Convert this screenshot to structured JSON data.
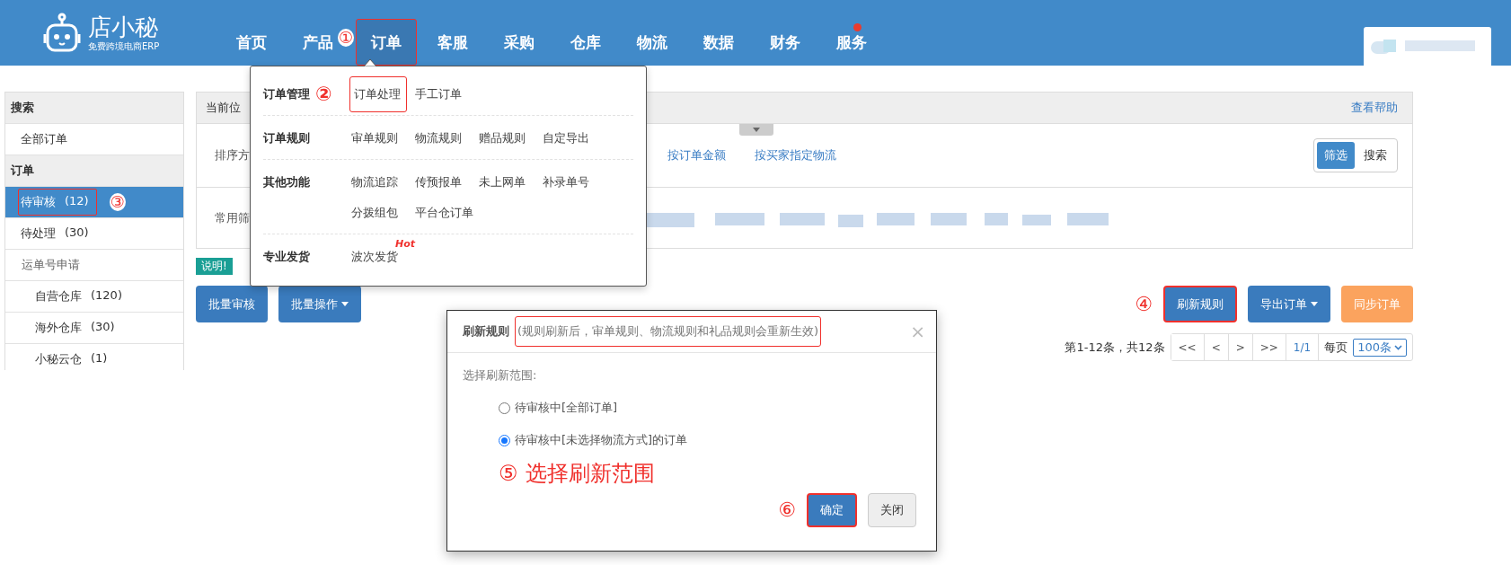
{
  "app": {
    "logo_name": "店小秘",
    "logo_tagline": "免费跨境电商ERP"
  },
  "nav": [
    {
      "label": "首页",
      "selected": false,
      "highlighted": false,
      "notification": false
    },
    {
      "label": "产品",
      "selected": false,
      "highlighted": false,
      "notification": false
    },
    {
      "label": "订单",
      "selected": true,
      "highlighted": true,
      "notification": false,
      "annotation": "①"
    },
    {
      "label": "客服",
      "selected": false,
      "highlighted": false,
      "notification": false
    },
    {
      "label": "采购",
      "selected": false,
      "highlighted": false,
      "notification": false
    },
    {
      "label": "仓库",
      "selected": false,
      "highlighted": false,
      "notification": false
    },
    {
      "label": "物流",
      "selected": false,
      "highlighted": false,
      "notification": false
    },
    {
      "label": "数据",
      "selected": false,
      "highlighted": false,
      "notification": false
    },
    {
      "label": "财务",
      "selected": false,
      "highlighted": false,
      "notification": false
    },
    {
      "label": "服务",
      "selected": false,
      "highlighted": false,
      "notification": true
    }
  ],
  "sidebar": [
    {
      "kind": "header",
      "label": "搜索"
    },
    {
      "kind": "item",
      "label": "全部订单",
      "selected": false,
      "highlighted": false
    },
    {
      "kind": "header",
      "label": "订单"
    },
    {
      "kind": "item",
      "label": "待审核",
      "count": "(12)",
      "selected": true,
      "highlighted": true,
      "annotation": "③"
    },
    {
      "kind": "item",
      "label": "待处理",
      "count": "(30)",
      "selected": false,
      "highlighted": false
    },
    {
      "kind": "group",
      "label": "运单号申请",
      "children": [
        {
          "kind": "item",
          "label": "自营仓库",
          "count": "(120)",
          "selected": false,
          "highlighted": false
        },
        {
          "kind": "item",
          "label": "海外仓库",
          "count": "(30)",
          "selected": false,
          "highlighted": false
        },
        {
          "kind": "item",
          "label": "小秘云仓",
          "count": "(1)",
          "selected": false,
          "highlighted": false
        }
      ]
    }
  ],
  "main": {
    "breadcrumb": "当前位",
    "help_link": "查看帮助",
    "sort_label": "排序方",
    "sort_options": [
      "按订单金额",
      "按买家指定物流"
    ],
    "view_toggle": [
      {
        "label": "筛选",
        "selected": true
      },
      {
        "label": "搜索",
        "selected": false
      }
    ],
    "filter_label": "常用筛",
    "notice": "说明!",
    "left_actions": [
      {
        "label": "批量审核",
        "dropdown": false
      },
      {
        "label": "批量操作",
        "dropdown": true
      }
    ],
    "right_actions": [
      {
        "label": "刷新规则",
        "kind": "primary",
        "dropdown": false,
        "highlighted": true,
        "annotation": "④"
      },
      {
        "label": "导出订单",
        "kind": "primary",
        "dropdown": true,
        "highlighted": false
      },
      {
        "label": "同步订单",
        "kind": "warning",
        "dropdown": false,
        "highlighted": false
      }
    ],
    "pagination": {
      "summary": "第1-12条，共12条",
      "buttons": [
        "<<",
        "<",
        ">",
        ">>"
      ],
      "page": "1/1",
      "per_page_label": "每页",
      "per_page": "100条"
    }
  },
  "menu": {
    "sections": [
      {
        "label": "订单管理",
        "annotation": "②",
        "links": [
          {
            "label": "订单处理",
            "highlighted": true
          },
          {
            "label": "手工订单",
            "highlighted": false
          }
        ]
      },
      {
        "label": "订单规则",
        "links": [
          {
            "label": "审单规则",
            "highlighted": false
          },
          {
            "label": "物流规则",
            "highlighted": false
          },
          {
            "label": "赠品规则",
            "highlighted": false
          },
          {
            "label": "自定导出",
            "highlighted": false
          }
        ]
      },
      {
        "label": "其他功能",
        "links": [
          {
            "label": "物流追踪",
            "highlighted": false
          },
          {
            "label": "传预报单",
            "highlighted": false
          },
          {
            "label": "未上网单",
            "highlighted": false
          },
          {
            "label": "补录单号",
            "highlighted": false
          },
          {
            "label": "分拨组包",
            "highlighted": false
          },
          {
            "label": "平台仓订单",
            "highlighted": false
          }
        ]
      },
      {
        "label": "专业发货",
        "links": [
          {
            "label": "波次发货",
            "highlighted": false,
            "badge": "Hot"
          }
        ]
      }
    ]
  },
  "dialog": {
    "title": "刷新规则",
    "subtitle": "(规则刷新后，审单规则、物流规则和礼品规则会重新生效)",
    "subtitle_highlighted": true,
    "close": "×",
    "prompt": "选择刷新范围:",
    "options": [
      {
        "label": "待审核中[全部订单]",
        "selected": false
      },
      {
        "label": "待审核中[未选择物流方式]的订单",
        "selected": true
      }
    ],
    "note": {
      "annotation": "⑤",
      "text": "选择刷新范围"
    },
    "buttons": [
      {
        "label": "确定",
        "kind": "primary",
        "highlighted": true,
        "annotation": "⑥"
      },
      {
        "label": "关闭",
        "kind": "default",
        "highlighted": false
      }
    ]
  }
}
